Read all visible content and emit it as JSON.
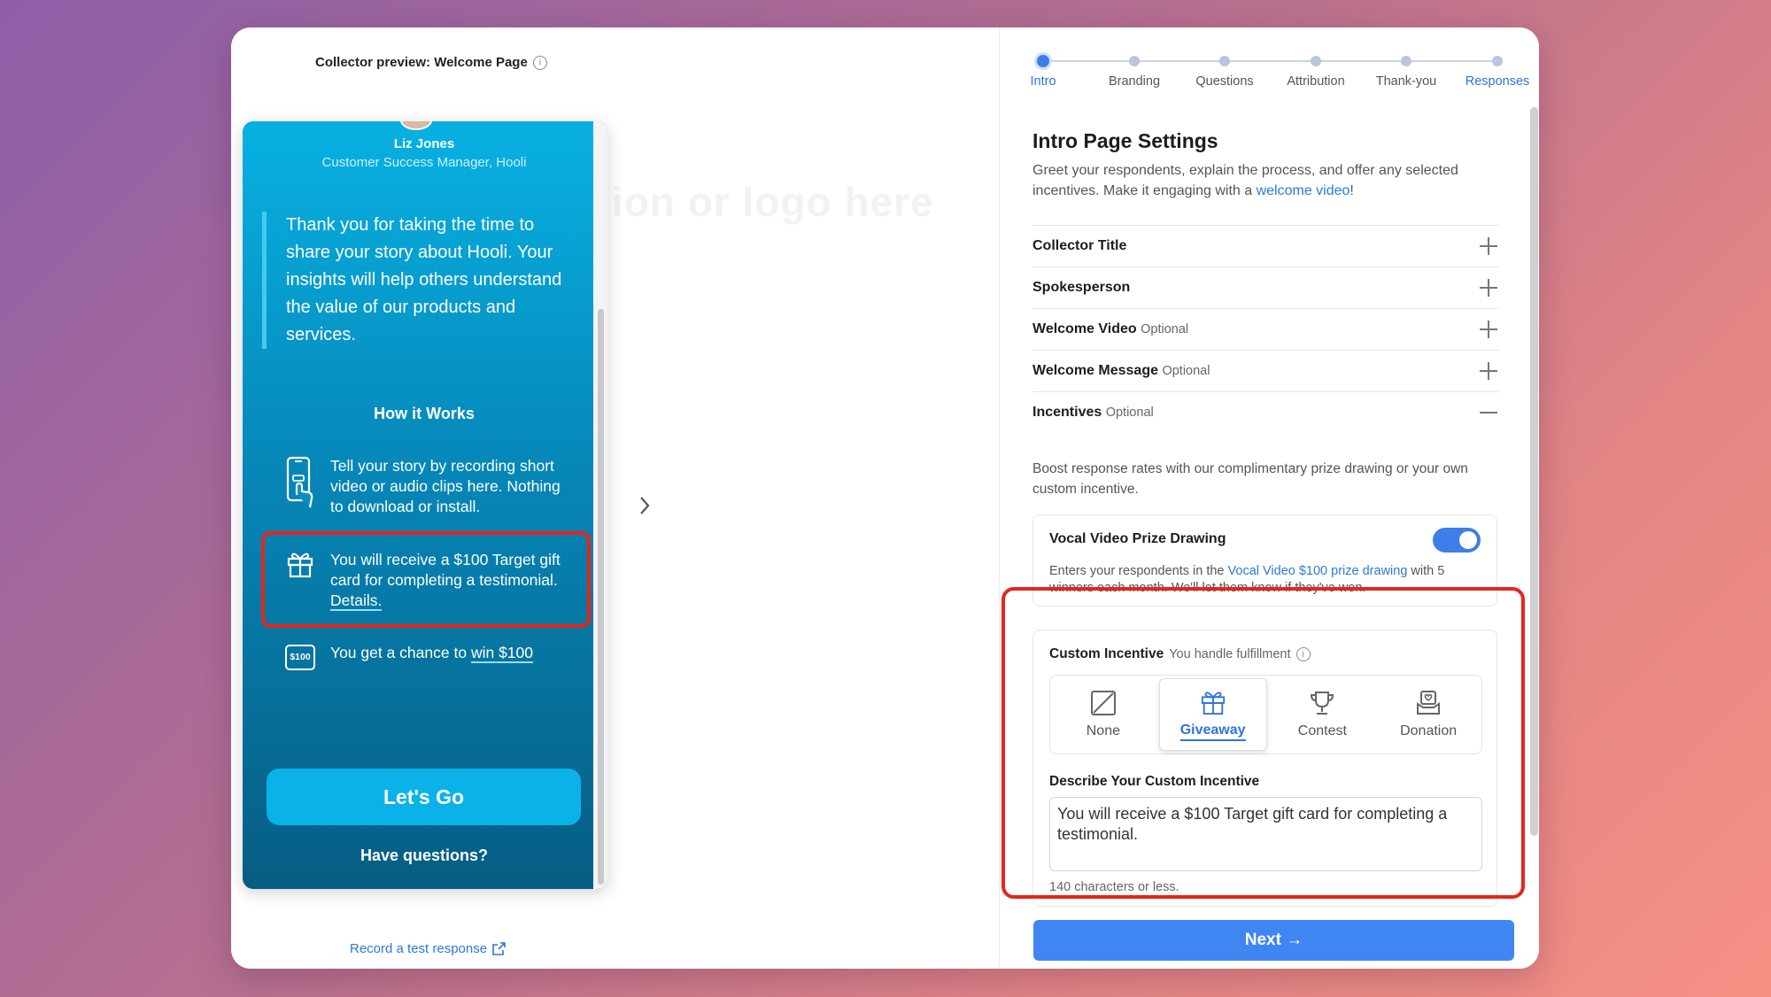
{
  "preview": {
    "title": "Collector preview: Welcome Page",
    "ghost_text": "ion or logo here",
    "record_link": "Record a test response"
  },
  "phone": {
    "spokesperson_name": "Liz Jones",
    "spokesperson_role": "Customer Success Manager, Hooli",
    "quote": "Thank you for taking the time to share your story about Hooli. Your insights will help others understand the value of our products and services.",
    "how_it_works": "How it Works",
    "step1": "Tell your story by recording short video or audio clips here. Nothing to download or install.",
    "step2_prefix": "You will receive a $100 Target gift card for completing a testimonial.",
    "step2_link": "Details.",
    "step3_prefix": "You get a chance to",
    "step3_link": "win $100",
    "badge": "$100",
    "cta": "Let's Go",
    "questions": "Have questions?"
  },
  "stepper": {
    "steps": [
      "Intro",
      "Branding",
      "Questions",
      "Attribution",
      "Thank-you",
      "Responses"
    ],
    "active": "Intro"
  },
  "settings": {
    "title": "Intro Page Settings",
    "desc_prefix": "Greet your respondents, explain the process, and offer any selected incentives. Make it engaging with a",
    "desc_link": "welcome video",
    "desc_suffix": "!",
    "sections": [
      {
        "label": "Collector Title",
        "optional": ""
      },
      {
        "label": "Spokesperson",
        "optional": ""
      },
      {
        "label": "Welcome Video",
        "optional": "Optional"
      },
      {
        "label": "Welcome Message",
        "optional": "Optional"
      },
      {
        "label": "Incentives",
        "optional": "Optional"
      }
    ],
    "incentives_desc": "Boost response rates with our complimentary prize drawing or your own custom incentive.",
    "prize": {
      "title": "Vocal Video Prize Drawing",
      "enabled": true,
      "desc_prefix": "Enters your respondents in the",
      "desc_link": "Vocal Video $100 prize drawing",
      "desc_suffix": "with 5 winners each month. We'll let them know if they've won."
    },
    "custom": {
      "title": "Custom Incentive",
      "subtitle": "You handle fulfillment",
      "options": [
        "None",
        "Giveaway",
        "Contest",
        "Donation"
      ],
      "selected": "Giveaway",
      "describe_label": "Describe Your Custom Incentive",
      "describe_value": "You will receive a $100 Target gift card for completing a testimonial.",
      "help": "140 characters or less."
    },
    "next": "Next →"
  },
  "colors": {
    "accent": "#3d7ee9",
    "highlight": "#e4261b",
    "phone_top": "#08b1e3",
    "phone_bottom": "#065d83"
  }
}
